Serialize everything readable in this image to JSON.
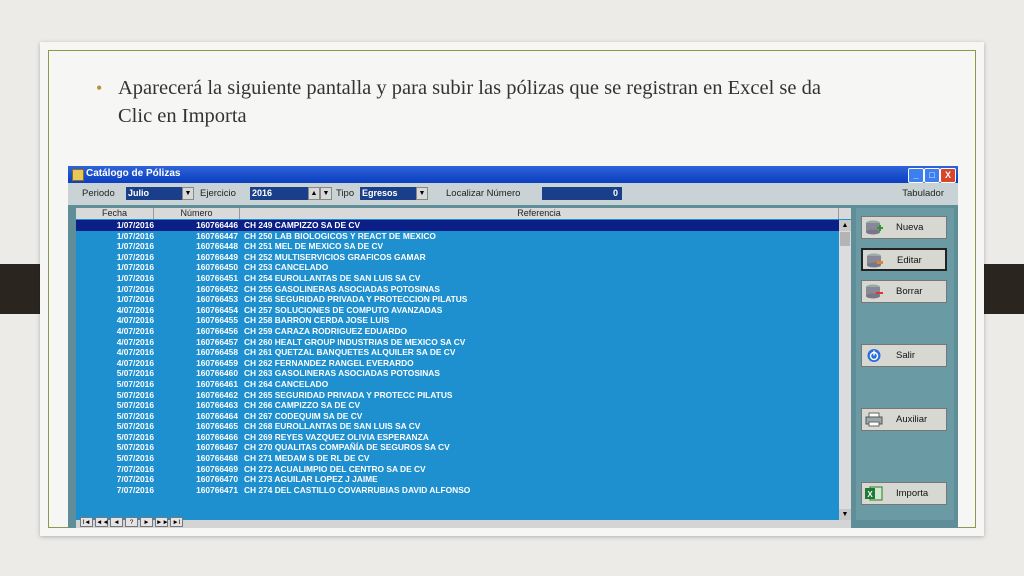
{
  "slide": {
    "bullet": "Aparecerá la siguiente pantalla y para subir las pólizas que se registran en Excel se da Clic en Importa"
  },
  "window": {
    "title": "Catálogo de Pólizas",
    "controls": {
      "minimize": "_",
      "maximize": "□",
      "close": "X"
    }
  },
  "toolbar": {
    "periodo_label": "Periodo",
    "periodo_value": "Julio",
    "ejercicio_label": "Ejercicio",
    "ejercicio_value": "2016",
    "tipo_label": "Tipo",
    "tipo_value": "Egresos",
    "localizar_label": "Localizar Número",
    "localizar_value": "0",
    "tabulador_label": "Tabulador"
  },
  "grid": {
    "columns": [
      "Fecha",
      "Número",
      "Referencia"
    ],
    "rows": [
      [
        "1/07/2016",
        "160766446",
        "CH 249 CAMPIZZO SA DE CV"
      ],
      [
        "1/07/2016",
        "160766447",
        "CH 250 LAB BIOLOGICOS Y REACT DE MEXICO"
      ],
      [
        "1/07/2016",
        "160766448",
        "CH 251 MEL DE MEXICO SA DE CV"
      ],
      [
        "1/07/2016",
        "160766449",
        "CH 252 MULTISERVICIOS GRAFICOS GAMAR"
      ],
      [
        "1/07/2016",
        "160766450",
        "CH 253 CANCELADO"
      ],
      [
        "1/07/2016",
        "160766451",
        "CH 254 EUROLLANTAS DE SAN LUIS SA CV"
      ],
      [
        "1/07/2016",
        "160766452",
        "CH 255 GASOLINERAS ASOCIADAS POTOSINAS"
      ],
      [
        "1/07/2016",
        "160766453",
        "CH 256 SEGURIDAD PRIVADA Y PROTECCION PILATUS"
      ],
      [
        "4/07/2016",
        "160766454",
        "CH 257 SOLUCIONES DE COMPUTO AVANZADAS"
      ],
      [
        "4/07/2016",
        "160766455",
        "CH 258 BARRON CERDA JOSE LUIS"
      ],
      [
        "4/07/2016",
        "160766456",
        "CH 259 CARAZA RODRIGUEZ EDUARDO"
      ],
      [
        "4/07/2016",
        "160766457",
        "CH 260 HEALT GROUP INDUSTRIAS DE MEXICO SA CV"
      ],
      [
        "4/07/2016",
        "160766458",
        "CH 261 QUETZAL BANQUETES ALQUILER SA DE CV"
      ],
      [
        "4/07/2016",
        "160766459",
        "CH 262 FERNANDEZ RANGEL EVERARDO"
      ],
      [
        "5/07/2016",
        "160766460",
        "CH 263 GASOLINERAS ASOCIADAS POTOSINAS"
      ],
      [
        "5/07/2016",
        "160766461",
        "CH 264 CANCELADO"
      ],
      [
        "5/07/2016",
        "160766462",
        "CH 265 SEGURIDAD PRIVADA Y PROTECC PILATUS"
      ],
      [
        "5/07/2016",
        "160766463",
        "CH 266 CAMPIZZO SA DE CV"
      ],
      [
        "5/07/2016",
        "160766464",
        "CH 267 CODEQUIM SA DE CV"
      ],
      [
        "5/07/2016",
        "160766465",
        "CH 268 EUROLLANTAS DE SAN LUIS SA CV"
      ],
      [
        "5/07/2016",
        "160766466",
        "CH 269 REYES VAZQUEZ OLIVIA ESPERANZA"
      ],
      [
        "5/07/2016",
        "160766467",
        "CH 270 QUALITAS COMPAÑÍA DE SEGUROS SA CV"
      ],
      [
        "5/07/2016",
        "160766468",
        "CH 271 MEDAM S DE RL DE CV"
      ],
      [
        "7/07/2016",
        "160766469",
        "CH 272 ACUALIMPIO DEL CENTRO SA DE CV"
      ],
      [
        "7/07/2016",
        "160766470",
        "CH 273 AGUILAR LOPEZ J JAIME"
      ],
      [
        "7/07/2016",
        "160766471",
        "CH 274 DEL CASTILLO COVARRUBIAS DAVID ALFONSO"
      ]
    ]
  },
  "navigator": [
    "I◄",
    "◄◄",
    "◄",
    "?",
    "►",
    "►►",
    "►I"
  ],
  "buttons": {
    "nueva": "Nueva",
    "editar": "Editar",
    "borrar": "Borrar",
    "salir": "Salir",
    "auxiliar": "Auxiliar",
    "importa": "Importa"
  }
}
